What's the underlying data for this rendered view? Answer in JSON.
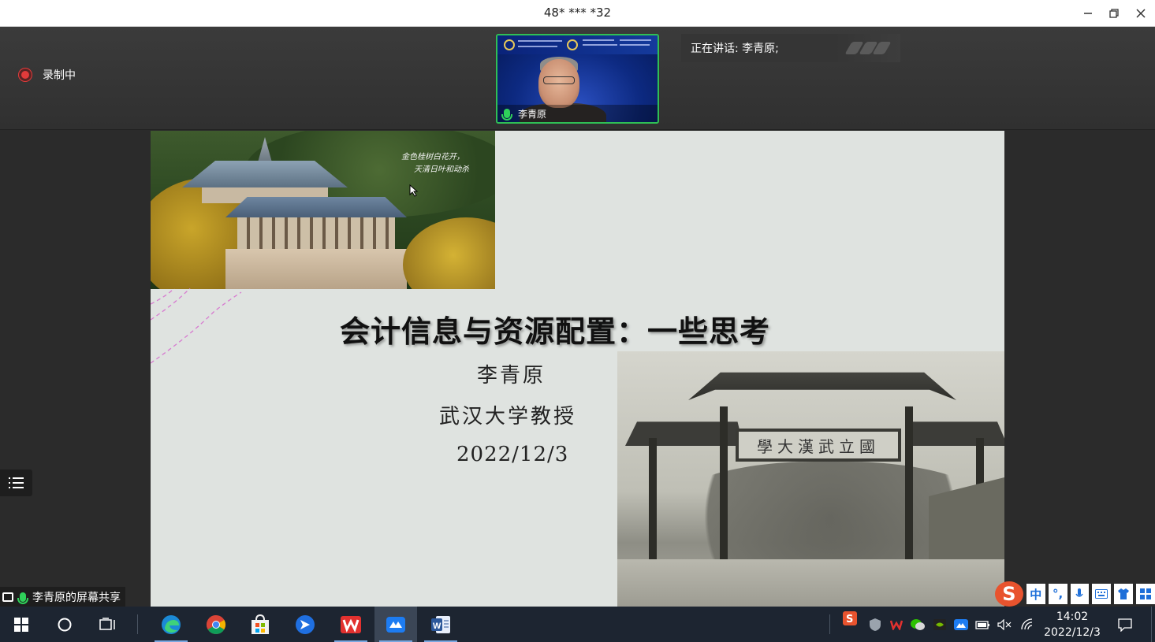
{
  "window": {
    "title": "48* *** *32"
  },
  "recording": {
    "label": "录制中"
  },
  "camera": {
    "name": "李青原"
  },
  "speaking": {
    "label": "正在讲话: 李青原;"
  },
  "slide": {
    "title": "会计信息与资源配置：一些思考",
    "presenter": "李青原",
    "affiliation": "武汉大学教授",
    "date": "2022/12/3",
    "poem_line1": "金色桂树白花开，",
    "poem_line2": "天清日叶和动杀",
    "gate_text": "學大漢武立國"
  },
  "share": {
    "label": "李青原的屏幕共享"
  },
  "ime": {
    "mode": "中",
    "punct": "°,"
  },
  "clock": {
    "time": "14:02",
    "date": "2022/12/3"
  },
  "colors": {
    "accent_green": "#2fbf55",
    "record_red": "#e23b3b",
    "taskbar": "#1d2531"
  }
}
